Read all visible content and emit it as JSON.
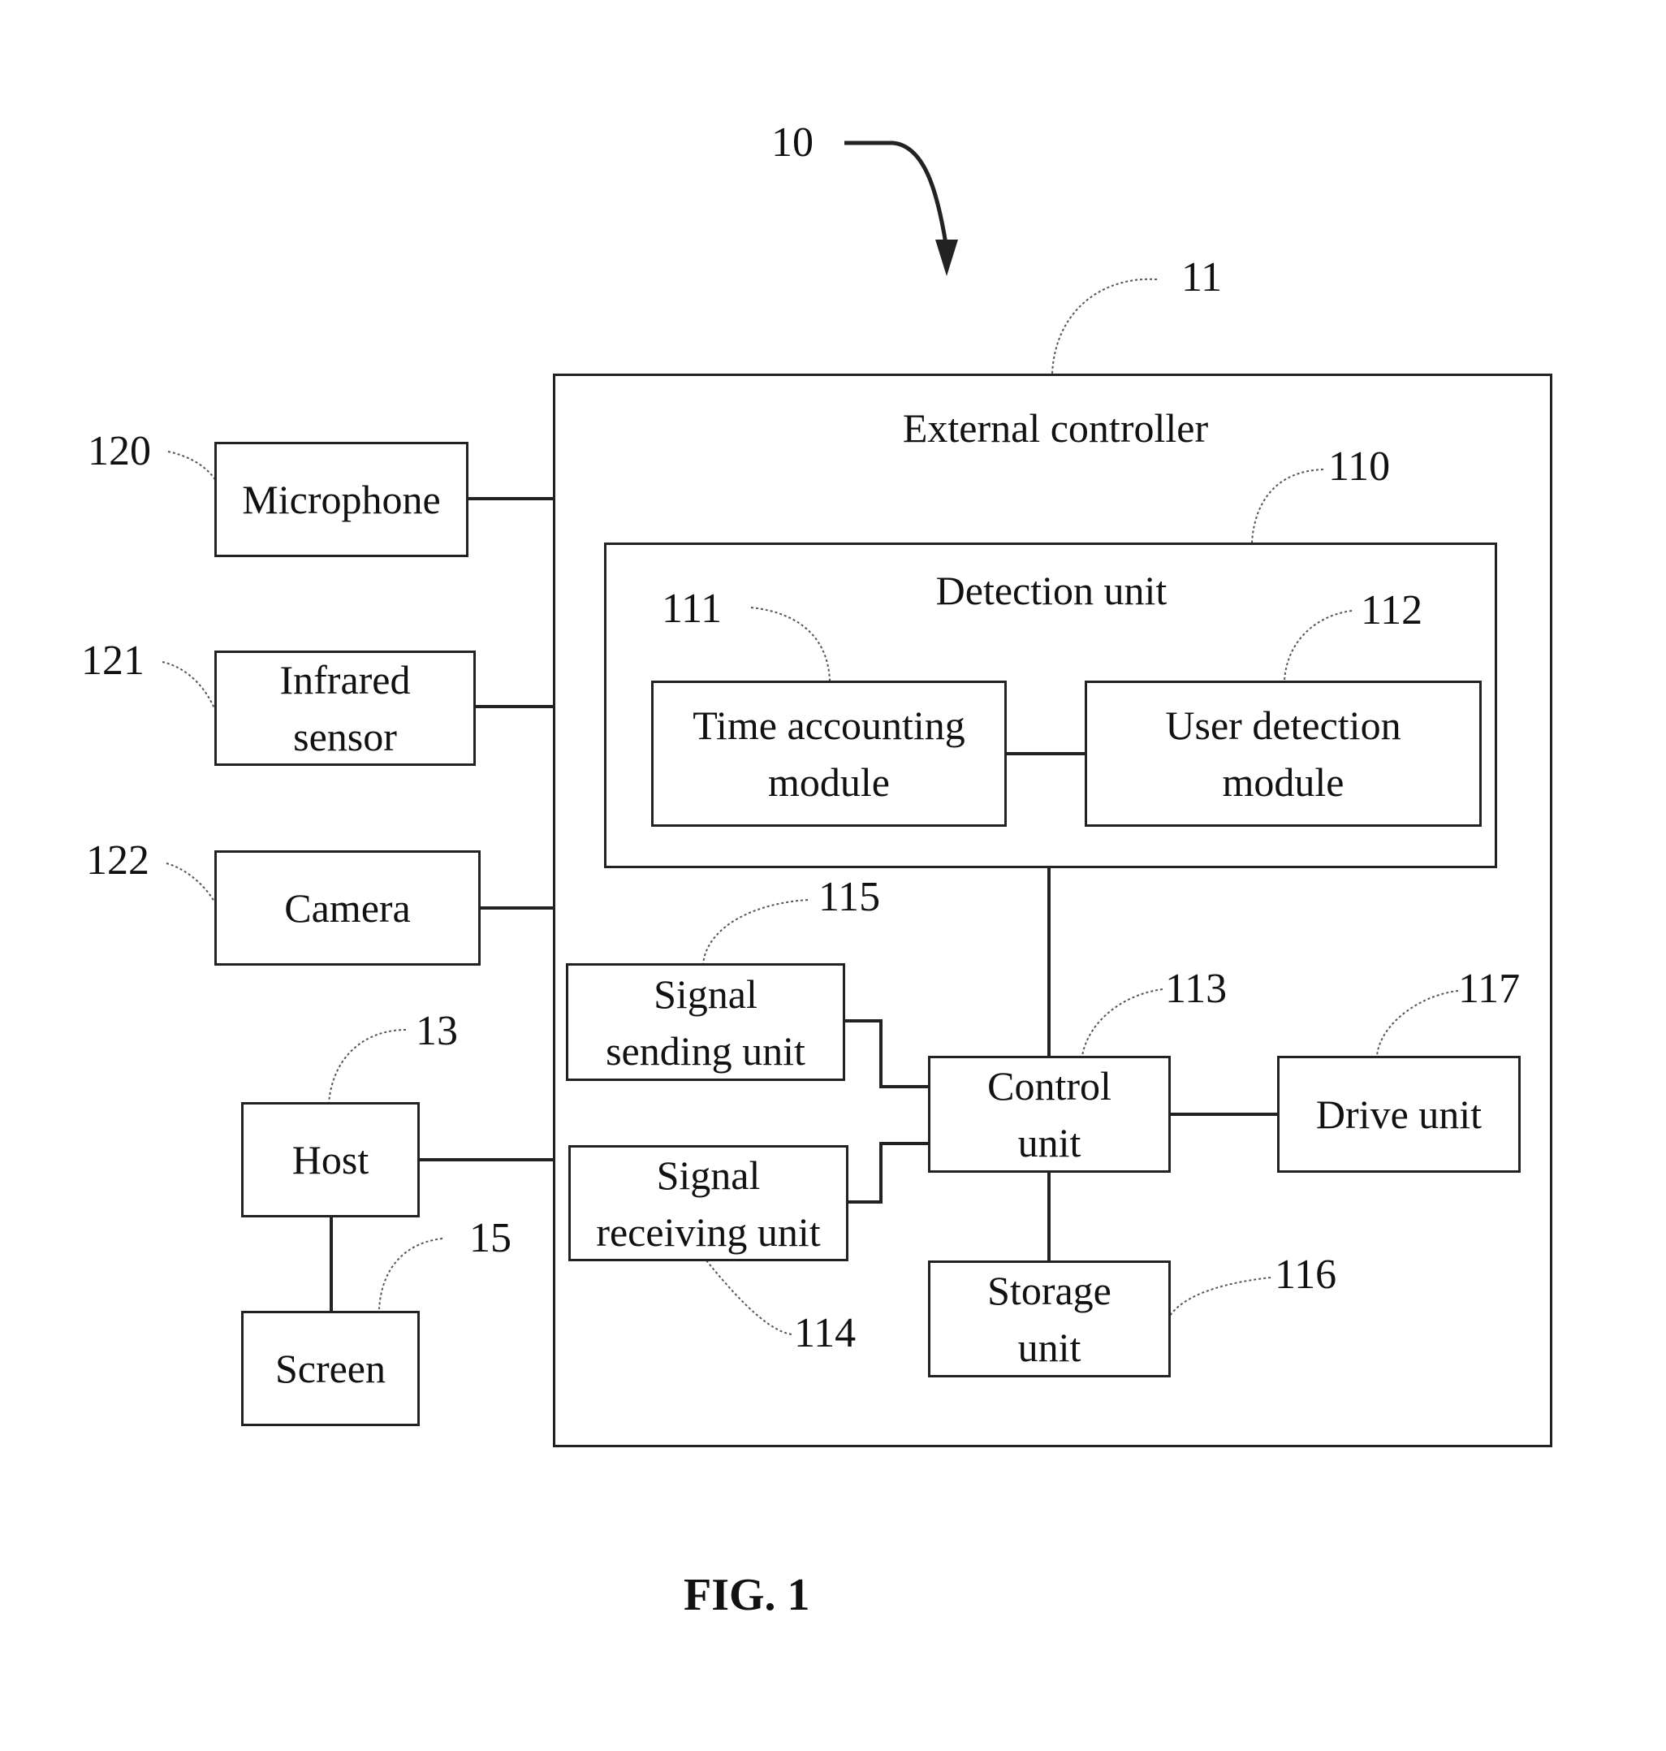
{
  "diagram": {
    "figure_caption": "FIG. 1",
    "system_ref": "10",
    "external_controller": {
      "ref": "11",
      "label": "External controller"
    },
    "detection_unit": {
      "ref": "110",
      "label": "Detection unit"
    },
    "time_accounting_module": {
      "ref": "111",
      "label_line1": "Time accounting",
      "label_line2": "module"
    },
    "user_detection_module": {
      "ref": "112",
      "label_line1": "User detection",
      "label_line2": "module"
    },
    "control_unit": {
      "ref": "113",
      "label_line1": "Control",
      "label_line2": "unit"
    },
    "signal_receiving_unit": {
      "ref": "114",
      "label_line1": "Signal",
      "label_line2": "receiving unit"
    },
    "signal_sending_unit": {
      "ref": "115",
      "label_line1": "Signal",
      "label_line2": "sending unit"
    },
    "storage_unit": {
      "ref": "116",
      "label_line1": "Storage",
      "label_line2": "unit"
    },
    "drive_unit": {
      "ref": "117",
      "label": "Drive unit"
    },
    "microphone": {
      "ref": "120",
      "label": "Microphone"
    },
    "infrared_sensor": {
      "ref": "121",
      "label_line1": "Infrared",
      "label_line2": "sensor"
    },
    "camera": {
      "ref": "122",
      "label": "Camera"
    },
    "host": {
      "ref": "13",
      "label": "Host"
    },
    "screen": {
      "ref": "15",
      "label": "Screen"
    }
  }
}
